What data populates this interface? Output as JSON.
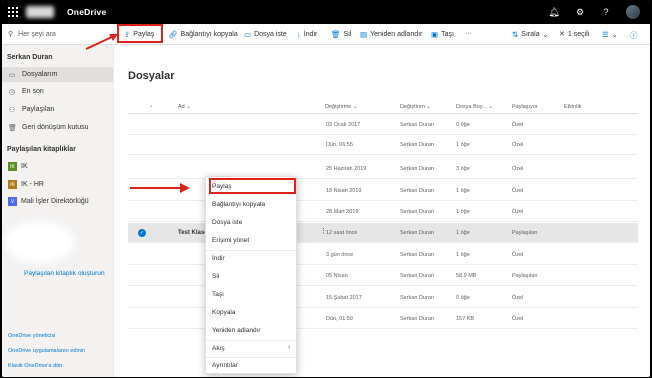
{
  "app": {
    "title": "OneDrive"
  },
  "topbar": {
    "icons": [
      "bell-icon",
      "gear-icon",
      "help-icon"
    ]
  },
  "cmdbar": {
    "search_placeholder": "Her şeyi ara",
    "share": "Paylaş",
    "copy_link": "Bağlantıyı kopyala",
    "request_files": "Dosya iste",
    "download": "İndir",
    "delete": "Sil",
    "rename": "Yeniden adlandır",
    "move": "Taşı",
    "more": "···",
    "sort": "Sırala",
    "selected": "1 seçili"
  },
  "sidebar": {
    "user": "Serkan Duran",
    "items": [
      {
        "label": "Dosyalarım",
        "icon": "folder-icon"
      },
      {
        "label": "En son",
        "icon": "clock-icon"
      },
      {
        "label": "Paylaşılan",
        "icon": "people-icon"
      },
      {
        "label": "Geri dönüşüm kutusu",
        "icon": "trash-icon"
      }
    ],
    "libraries_heading": "Paylaşılan kitaplıklar",
    "libraries": [
      {
        "label": "IK",
        "badge": "IK",
        "color": "#5b8c1f"
      },
      {
        "label": "IK - HR",
        "badge": "IK",
        "color": "#b07b1a"
      },
      {
        "label": "Mali İşler Direktörlüğü",
        "badge": "V",
        "color": "#4f6bed"
      }
    ],
    "create_library": "Paylaşılan kitaplık oluşturun",
    "footer": [
      "OneDrive yöneticisi",
      "OneDrive uygulamalarını edinin",
      "Klasik OneDrive'a dön"
    ]
  },
  "main": {
    "title": "Dosyalar",
    "columns": [
      "Ad",
      "Değiştirme",
      "Değiştiren",
      "Dosya Boy...",
      "Paylaşıyor",
      "Etkinlik"
    ],
    "rows": [
      {
        "name": "",
        "modified": "03 Ocak 2017",
        "by": "Serkan Duran",
        "size": "0 öğe",
        "sharing": "Özel",
        "selected": false
      },
      {
        "name": "",
        "modified": "Dün, 06:55",
        "by": "Serkan Duran",
        "size": "1 öğe",
        "sharing": "Özel",
        "selected": false
      },
      {
        "name": "",
        "modified": "25 Haziran 2019",
        "by": "Serkan Duran",
        "size": "3 öğe",
        "sharing": "Özel",
        "selected": false
      },
      {
        "name": "",
        "modified": "18 Nisan 2019",
        "by": "Serkan Duran",
        "size": "1 öğe",
        "sharing": "Özel",
        "selected": false
      },
      {
        "name": "",
        "modified": "28 Mart 2019",
        "by": "Serkan Duran",
        "size": "1 öğe",
        "sharing": "Özel",
        "selected": false
      },
      {
        "name": "Test Klasö",
        "modified": "12 saat önce",
        "by": "Serkan Duran",
        "size": "1 öğe",
        "sharing": "Paylaşılan",
        "selected": true
      },
      {
        "name": "",
        "modified": "3 gün önce",
        "by": "Serkan Duran",
        "size": "1 öğe",
        "sharing": "Özel",
        "selected": false
      },
      {
        "name": "",
        "modified": "05 Nisan",
        "by": "Serkan Duran",
        "size": "58,9 MB",
        "sharing": "Paylaşılan",
        "selected": false
      },
      {
        "name": "",
        "modified": "15 Şubat 2017",
        "by": "Serkan Duran",
        "size": "0 öğe",
        "sharing": "Özel",
        "selected": false
      },
      {
        "name": "",
        "modified": "Dün, 01:59",
        "by": "Serkan Duran",
        "size": "157 KB",
        "sharing": "Özel",
        "selected": false
      }
    ]
  },
  "context_menu": {
    "items": [
      "Paylaş",
      "Bağlantıyı kopyala",
      "Dosya iste",
      "Erişimi yönet",
      "İndir",
      "Sil",
      "Taşı",
      "Kopyala",
      "Yeniden adlandır",
      "Akış",
      "Ayrıntılar"
    ],
    "flow_suffix": "‹"
  },
  "annotation": {
    "color": "#e0201a"
  }
}
